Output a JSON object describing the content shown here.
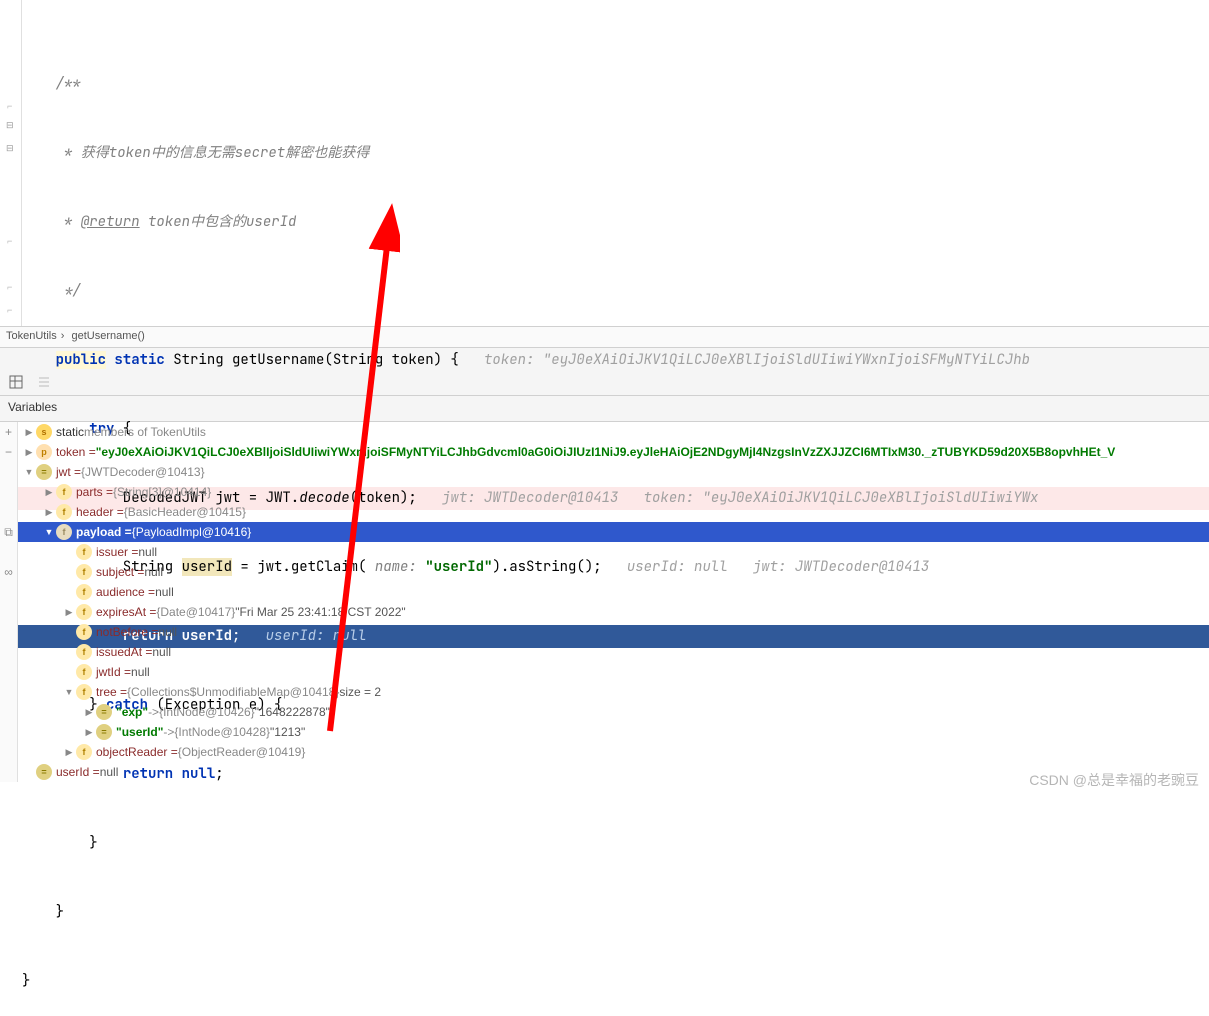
{
  "code": {
    "c1": "/**",
    "c2": " * 获得token中的信息无需secret解密也能获得",
    "c3_pre": " * ",
    "c3_ret": "@return",
    "c3_post": " token中包含的userId",
    "c4": " */",
    "l5_kw_public": "public",
    "l5_kw_static": "static",
    "l5_sig": " String getUsername(String token) {",
    "l5_hint": "token: \"eyJ0eXAiOiJKV1QiLCJ0eXBlIjoiSldUIiwiYWxnIjoiSFMyNTYiLCJhb",
    "l6_kw_try": "try",
    "l6_brace": " {",
    "l7_a": "            DecodedJWT jwt = JWT.",
    "l7_decode": "decode",
    "l7_b": "(token);",
    "l7_hint": "jwt: JWTDecoder@10413   token: \"eyJ0eXAiOiJKV1QiLCJ0eXBlIjoiSldUIiwiYWx",
    "l8_a": "            String ",
    "l8_var": "userId",
    "l8_b": " = jwt.getClaim(",
    "l8_pname": " name: ",
    "l8_str": "\"userId\"",
    "l8_c": ").asString();",
    "l8_hint": "userId: null   jwt: JWTDecoder@10413",
    "l9_kw_ret": "return",
    "l9_var": "userId",
    "l9_semi": ";",
    "l9_hint": "userId: null",
    "l10_a": "        } ",
    "l10_kw_catch": "catch",
    "l10_b": " (Exception e) {",
    "l11_a": "            ",
    "l11_kw_ret": "return",
    "l11_b": " ",
    "l11_kw_null": "null",
    "l11_c": ";",
    "l12": "        }",
    "l13": "    }",
    "l14": "}"
  },
  "breadcrumb": {
    "a": "TokenUtils",
    "b": "getUsername()"
  },
  "tabs": {
    "variables": "Variables"
  },
  "vars": {
    "r0_name": "static ",
    "r0_val": "members of TokenUtils",
    "r1_name": "token = ",
    "r1_val": "\"eyJ0eXAiOiJKV1QiLCJ0eXBlIjoiSldUIiwiYWxnIjoiSFMyNTYiLCJhbGdvcml0aG0iOiJIUzI1NiJ9.eyJleHAiOjE2NDgyMjI4NzgsInVzZXJJZCI6MTIxM30._zTUBYKD59d20X5B8opvhHEt_V",
    "r2_name": "jwt = ",
    "r2_val": "{JWTDecoder@10413}",
    "r3_name": "parts = ",
    "r3_val": "{String[3]@10414}",
    "r4_name": "header = ",
    "r4_val": "{BasicHeader@10415}",
    "r5_name": "payload = ",
    "r5_val": "{PayloadImpl@10416}",
    "r6_name": "issuer = ",
    "r6_val": "null",
    "r7_name": "subject = ",
    "r7_val": "null",
    "r8_name": "audience = ",
    "r8_val": "null",
    "r9_name": "expiresAt = ",
    "r9_val": "{Date@10417}",
    "r9_str": " \"Fri Mar 25 23:41:18 CST 2022\"",
    "r10_name": "notBefore = ",
    "r10_val": "null",
    "r11_name": "issuedAt = ",
    "r11_val": "null",
    "r12_name": "jwtId = ",
    "r12_val": "null",
    "r13_name": "tree = ",
    "r13_val": "{Collections$UnmodifiableMap@10418}",
    "r13_size": "  size = 2",
    "r14_key": "\"exp\"",
    "r14_arrow": " -> ",
    "r14_val": "{IntNode@10426}",
    "r14_str": " \"1648222878\"",
    "r15_key": "\"userId\"",
    "r15_arrow": " -> ",
    "r15_val": "{IntNode@10428}",
    "r15_str": " \"1213\"",
    "r16_name": "objectReader = ",
    "r16_val": "{ObjectReader@10419}",
    "r17_name": "userId = ",
    "r17_val": "null"
  },
  "watermark": "CSDN @总是幸福的老豌豆"
}
